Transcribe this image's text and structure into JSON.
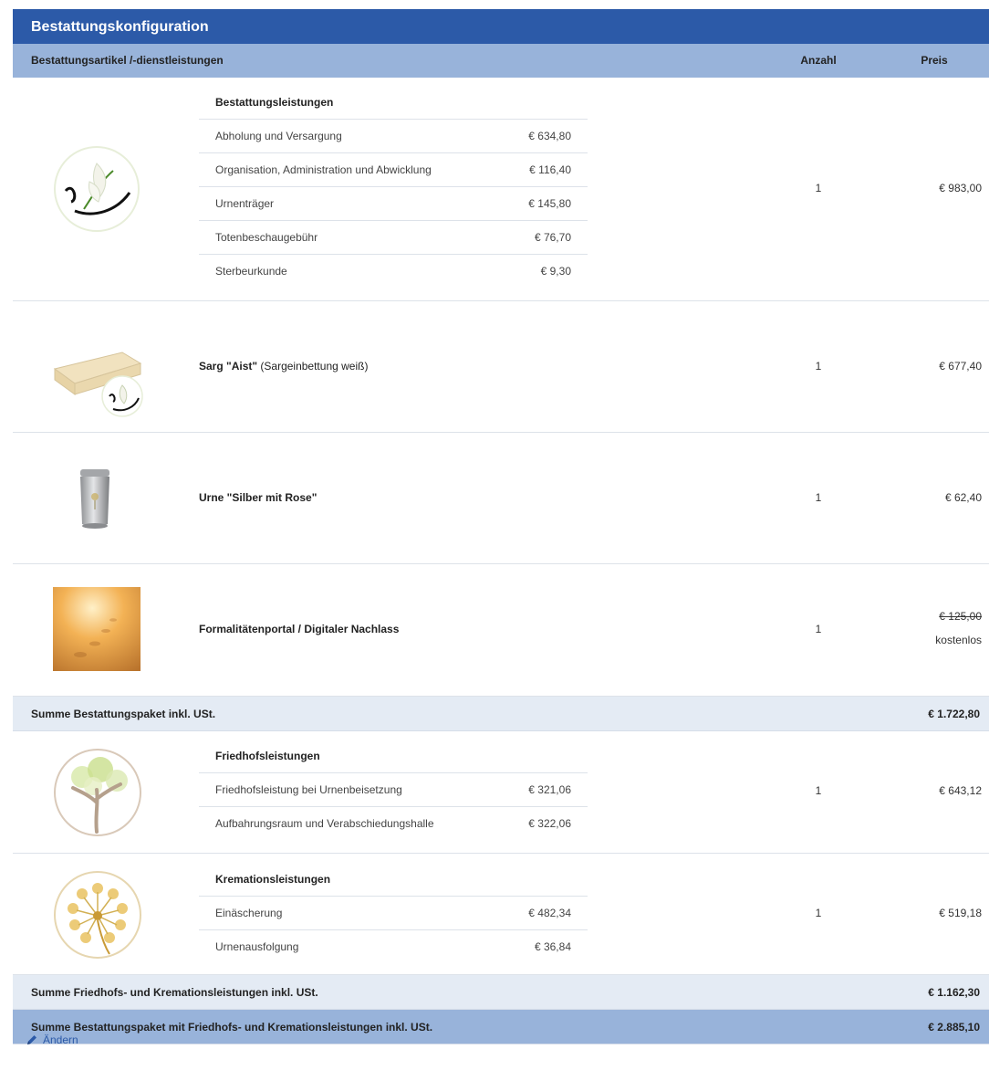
{
  "window": {
    "title": "Bestattungskonfiguration"
  },
  "table": {
    "headers": {
      "item": "Bestattungsartikel /-dienstleistungen",
      "qty": "Anzahl",
      "price": "Preis"
    }
  },
  "rows": {
    "services": {
      "title": "Bestattungsleistungen",
      "lines": [
        {
          "label": "Abholung und Versargung",
          "amount": "€ 634,80"
        },
        {
          "label": "Organisation, Administration und Abwicklung",
          "amount": "€ 116,40"
        },
        {
          "label": "Urnenträger",
          "amount": "€ 145,80"
        },
        {
          "label": "Totenbeschaugebühr",
          "amount": "€ 76,70"
        },
        {
          "label": "Sterbeurkunde",
          "amount": "€ 9,30"
        }
      ],
      "qty": "1",
      "price": "€ 983,00"
    },
    "coffin": {
      "name": "Sarg \"Aist\"",
      "detail": " (Sargeinbettung weiß)",
      "qty": "1",
      "price": "€ 677,40"
    },
    "urn": {
      "name": "Urne \"Silber mit Rose\"",
      "qty": "1",
      "price": "€ 62,40"
    },
    "portal": {
      "name": "Formalitätenportal / Digitaler Nachlass",
      "qty": "1",
      "old_price": "€ 125,00",
      "price": "kostenlos"
    },
    "sum_package": {
      "label": "Summe Bestattungspaket inkl. USt.",
      "value": "€ 1.722,80"
    },
    "cemetery": {
      "title": "Friedhofsleistungen",
      "lines": [
        {
          "label": "Friedhofsleistung bei Urnenbeisetzung",
          "amount": "€ 321,06"
        },
        {
          "label": "Aufbahrungsraum und Verabschiedungshalle",
          "amount": "€ 322,06"
        }
      ],
      "qty": "1",
      "price": "€ 643,12"
    },
    "cremation": {
      "title": "Kremationsleistungen",
      "lines": [
        {
          "label": "Einäscherung",
          "amount": "€ 482,34"
        },
        {
          "label": "Urnenausfolgung",
          "amount": "€ 36,84"
        }
      ],
      "qty": "1",
      "price": "€ 519,18"
    },
    "sum_cemetery": {
      "label": "Summe Friedhofs- und Kremationsleistungen inkl. USt.",
      "value": "€ 1.162,30"
    },
    "sum_total": {
      "label": "Summe Bestattungspaket mit Friedhofs- und Kremationsleistungen inkl. USt.",
      "value": "€ 2.885,10"
    }
  },
  "actions": {
    "edit_label": "Ändern"
  },
  "colors": {
    "title_bar": "#2c5aa8",
    "header_bar": "#98b3da",
    "sum_light": "#e4ebf4",
    "link": "#2c5aa8"
  }
}
